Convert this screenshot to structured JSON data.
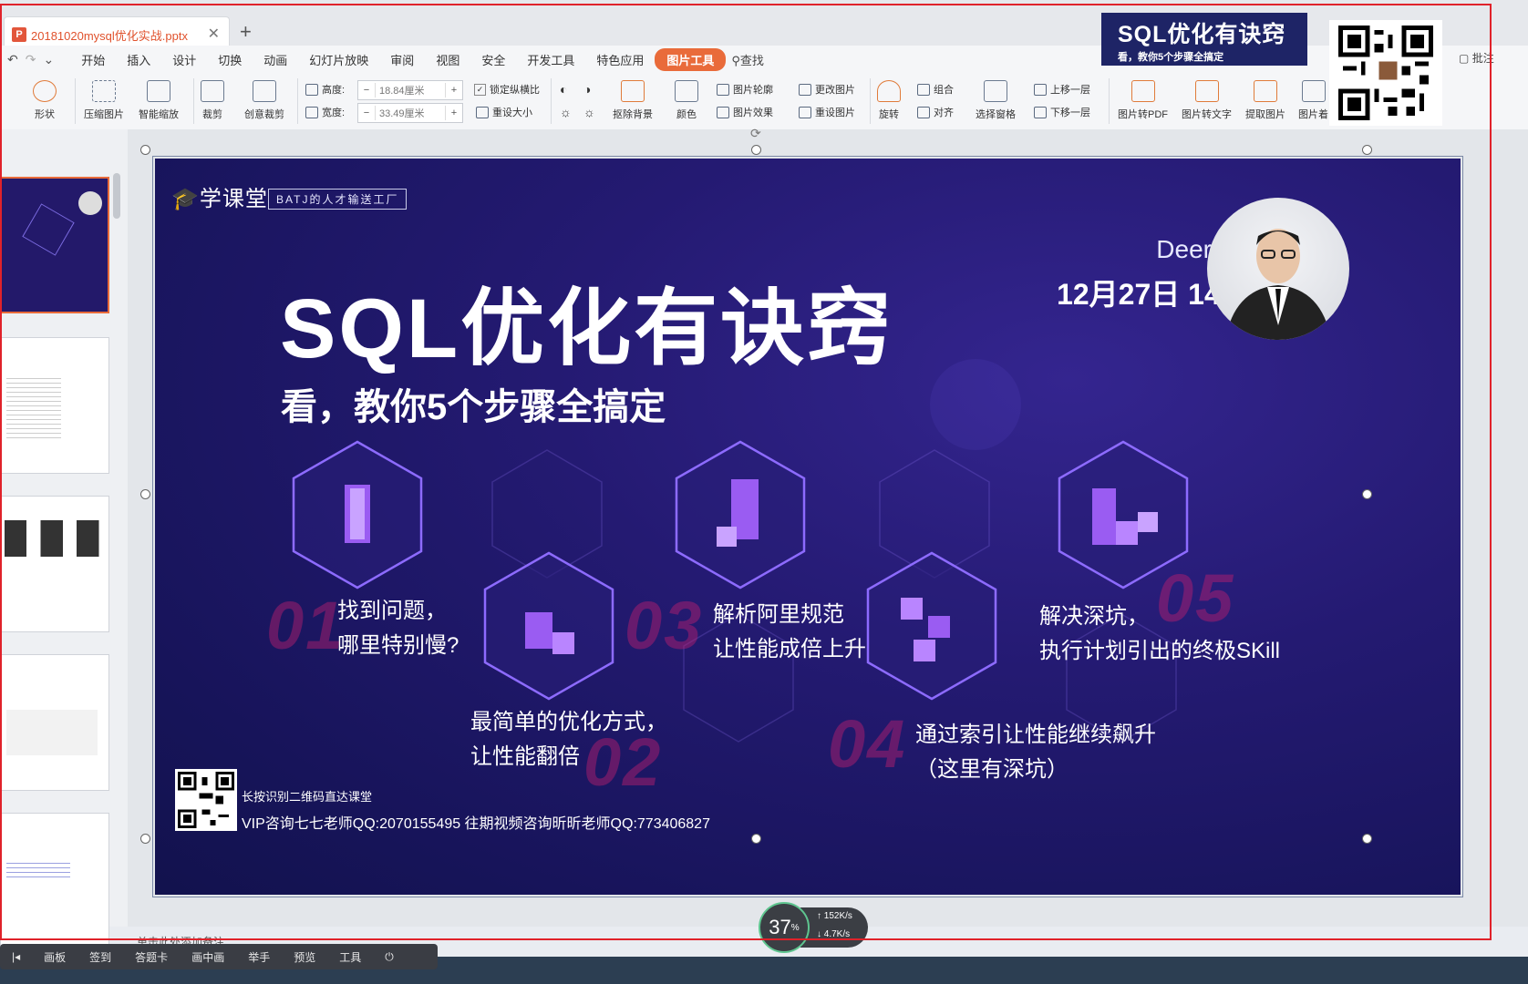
{
  "window": {
    "doc_tab_title": "20181020mysql优化实战.pptx"
  },
  "menu": {
    "items": [
      "开始",
      "插入",
      "设计",
      "切换",
      "动画",
      "幻灯片放映",
      "审阅",
      "视图",
      "安全",
      "开发工具",
      "特色应用"
    ],
    "active_tab": "图片工具",
    "search_label": "查找"
  },
  "ribbon": {
    "shape": "形状",
    "compress": "压缩图片",
    "smart_zoom": "智能缩放",
    "crop": "裁剪",
    "creative_crop": "创意裁剪",
    "height_label": "高度:",
    "height_value": "18.84厘米",
    "width_label": "宽度:",
    "width_value": "33.49厘米",
    "lock_ratio": "锁定纵横比",
    "reset_size": "重设大小",
    "remove_bg": "抠除背景",
    "color": "颜色",
    "outline": "图片轮廓",
    "effect": "图片效果",
    "change_pic": "更改图片",
    "reset_pic": "重设图片",
    "rotate": "旋转",
    "group": "组合",
    "align": "对齐",
    "select_pane": "选择窗格",
    "bring_forward": "上移一层",
    "send_backward": "下移一层",
    "to_pdf": "图片转PDF",
    "to_text": "图片转文字",
    "extract": "提取图片",
    "more": "图片着",
    "comment": "批注"
  },
  "banner": {
    "title": "SQL优化有诀窍",
    "subtitle": "看，教你5个步骤全搞定"
  },
  "slide": {
    "logo": "学课堂",
    "slogan": "BATJ的人才输送工厂",
    "teacher": "Deer老师",
    "date": "12月27日 14:30",
    "title": "SQL优化有诀窍",
    "subtitle": "看，教你5个步骤全搞定",
    "steps": [
      {
        "num": "01",
        "line1": "找到问题，",
        "line2": "哪里特别慢?"
      },
      {
        "num": "02",
        "line1": "最简单的优化方式，",
        "line2": "让性能翻倍"
      },
      {
        "num": "03",
        "line1": "解析阿里规范",
        "line2": "让性能成倍上升"
      },
      {
        "num": "04",
        "line1": "通过索引让性能继续飙升",
        "line2": "（这里有深坑）"
      },
      {
        "num": "05",
        "line1": "解决深坑，",
        "line2": "执行计划引出的终极SKill"
      }
    ],
    "qr_label": "长按识别二维码直达课堂",
    "contact": "VIP咨询七七老师QQ:2070155495    往期视频咨询昕昕老师QQ:773406827"
  },
  "notes_placeholder": "单击此处添加备注",
  "bottom_toolbar": [
    "画板",
    "签到",
    "答题卡",
    "画中画",
    "举手",
    "预览",
    "工具"
  ],
  "speed": {
    "percent": "37",
    "unit": "%",
    "up": "152K/s",
    "down": "4.7K/s"
  }
}
